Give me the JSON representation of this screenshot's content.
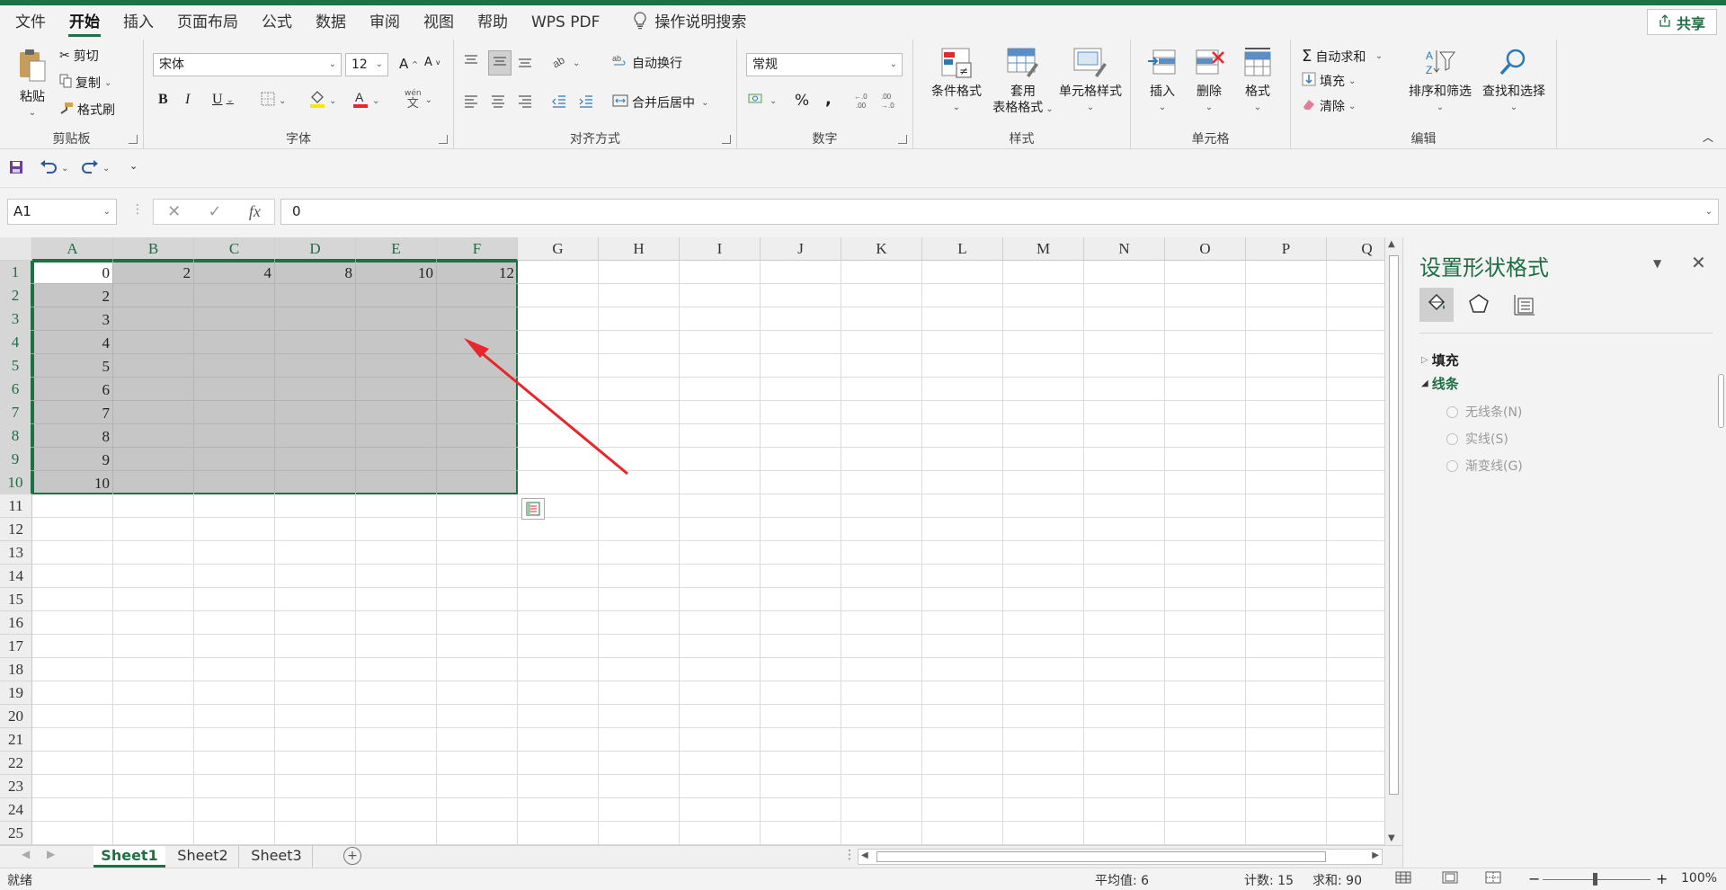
{
  "menu": {
    "tabs": [
      "文件",
      "开始",
      "插入",
      "页面布局",
      "公式",
      "数据",
      "审阅",
      "视图",
      "帮助",
      "WPS PDF"
    ],
    "active": "开始",
    "search_label": "操作说明搜索",
    "share_label": "共享"
  },
  "ribbon": {
    "clipboard": {
      "label": "剪贴板",
      "paste": "粘贴",
      "cut": "剪切",
      "copy": "复制",
      "format_painter": "格式刷"
    },
    "font": {
      "label": "字体",
      "font_name": "宋体",
      "font_size": "12",
      "bold": "B",
      "italic": "I",
      "underline": "U",
      "grow": "A",
      "shrink": "A",
      "phonetic": "文"
    },
    "alignment": {
      "label": "对齐方式",
      "wrap": "自动换行",
      "merge": "合并后居中"
    },
    "number": {
      "label": "数字",
      "format": "常规",
      "percent": "%",
      "comma": ","
    },
    "styles": {
      "label": "样式",
      "conditional": "条件格式",
      "table_top": "套用",
      "table_bottom": "表格格式",
      "cell_styles": "单元格样式"
    },
    "cells": {
      "label": "单元格",
      "insert": "插入",
      "delete": "删除",
      "format": "格式"
    },
    "editing": {
      "label": "编辑",
      "autosum": "自动求和",
      "fill": "填充",
      "clear": "清除",
      "sort": "排序和筛选",
      "find": "查找和选择"
    }
  },
  "formula_bar": {
    "name_box": "A1",
    "fx": "fx",
    "value": "0"
  },
  "grid": {
    "columns": [
      "A",
      "B",
      "C",
      "D",
      "E",
      "F",
      "G",
      "H",
      "I",
      "J",
      "K",
      "L",
      "M",
      "N",
      "O",
      "P",
      "Q"
    ],
    "rows": [
      "1",
      "2",
      "3",
      "4",
      "5",
      "6",
      "7",
      "8",
      "9",
      "10",
      "11",
      "12",
      "13",
      "14",
      "15",
      "16",
      "17",
      "18",
      "19",
      "20",
      "21",
      "22",
      "23",
      "24",
      "25"
    ],
    "row1": [
      "0",
      "2",
      "4",
      "8",
      "10",
      "12"
    ],
    "colA": [
      "2",
      "3",
      "4",
      "5",
      "6",
      "7",
      "8",
      "9",
      "10"
    ]
  },
  "sheet_tabs": [
    "Sheet1",
    "Sheet2",
    "Sheet3"
  ],
  "active_sheet": "Sheet1",
  "pane": {
    "title": "设置形状格式",
    "fill": "填充",
    "line": "线条",
    "options": [
      "无线条(N)",
      "实线(S)",
      "渐变线(G)"
    ]
  },
  "status": {
    "ready": "就绪",
    "average": "平均值: 6",
    "count": "计数: 15",
    "sum": "求和: 90",
    "zoom": "100%"
  },
  "colors": {
    "accent": "#1f7145",
    "selection": "#c6c6c6",
    "arrow": "#e8262b"
  }
}
